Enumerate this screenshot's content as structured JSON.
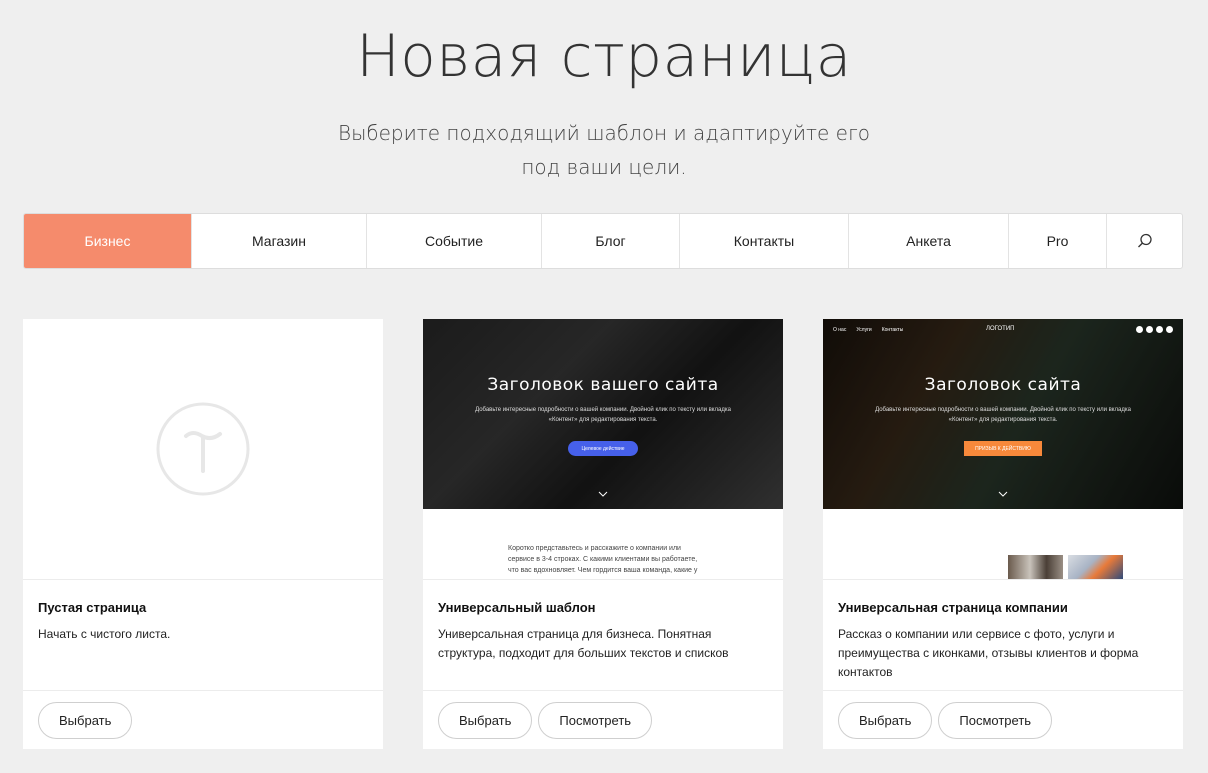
{
  "header": {
    "title": "Новая страница",
    "subtitle": "Выберите подходящий шаблон и адаптируйте его под ваши цели."
  },
  "tabs": [
    {
      "label": "Бизнес",
      "active": true
    },
    {
      "label": "Магазин"
    },
    {
      "label": "Событие"
    },
    {
      "label": "Блог"
    },
    {
      "label": "Контакты"
    },
    {
      "label": "Анкета"
    },
    {
      "label": "Pro"
    }
  ],
  "search_icon": "search-icon",
  "colors": {
    "accent": "#f58b6c",
    "background": "#efefef"
  },
  "cards": [
    {
      "title": "Пустая страница",
      "description": "Начать с чистого листа.",
      "select_label": "Выбрать"
    },
    {
      "title": "Универсальный шаблон",
      "description": "Универсальная страница для бизнеса. Понятная структура, подходит для больших текстов и списков",
      "select_label": "Выбрать",
      "view_label": "Посмотреть",
      "preview": {
        "heading": "Заголовок вашего сайта",
        "text": "Добавьте интересные подробности о вашей компании. Двойной клик по тексту или вкладка «Контент» для редактирования текста.",
        "button": "Целевое действие",
        "button_color": "#4660ea",
        "below_text": "Коротко представьтесь и расскажите о компании или сервисе в 3-4 строках. С какими клиентами вы работаете, что вас вдохновляет. Чем гордится ваша команда, какие у нее ценности и мотивация."
      }
    },
    {
      "title": "Универсальная страница компании",
      "description": "Рассказ о компании или сервисе с фото, услуги и преимущества с иконками, отзывы клиентов и форма контактов",
      "select_label": "Выбрать",
      "view_label": "Посмотреть",
      "preview": {
        "nav": [
          "О нас",
          "Услуги",
          "Контакты"
        ],
        "logo": "ЛОГОТИП",
        "heading": "Заголовок сайта",
        "text": "Добавьте интересные подробности о вашей компании. Двойной клик по тексту или вкладка «Контент» для редактирования текста.",
        "button": "ПРИЗЫВ К ДЕЙСТВИЮ",
        "button_color": "#f7893b"
      }
    }
  ]
}
